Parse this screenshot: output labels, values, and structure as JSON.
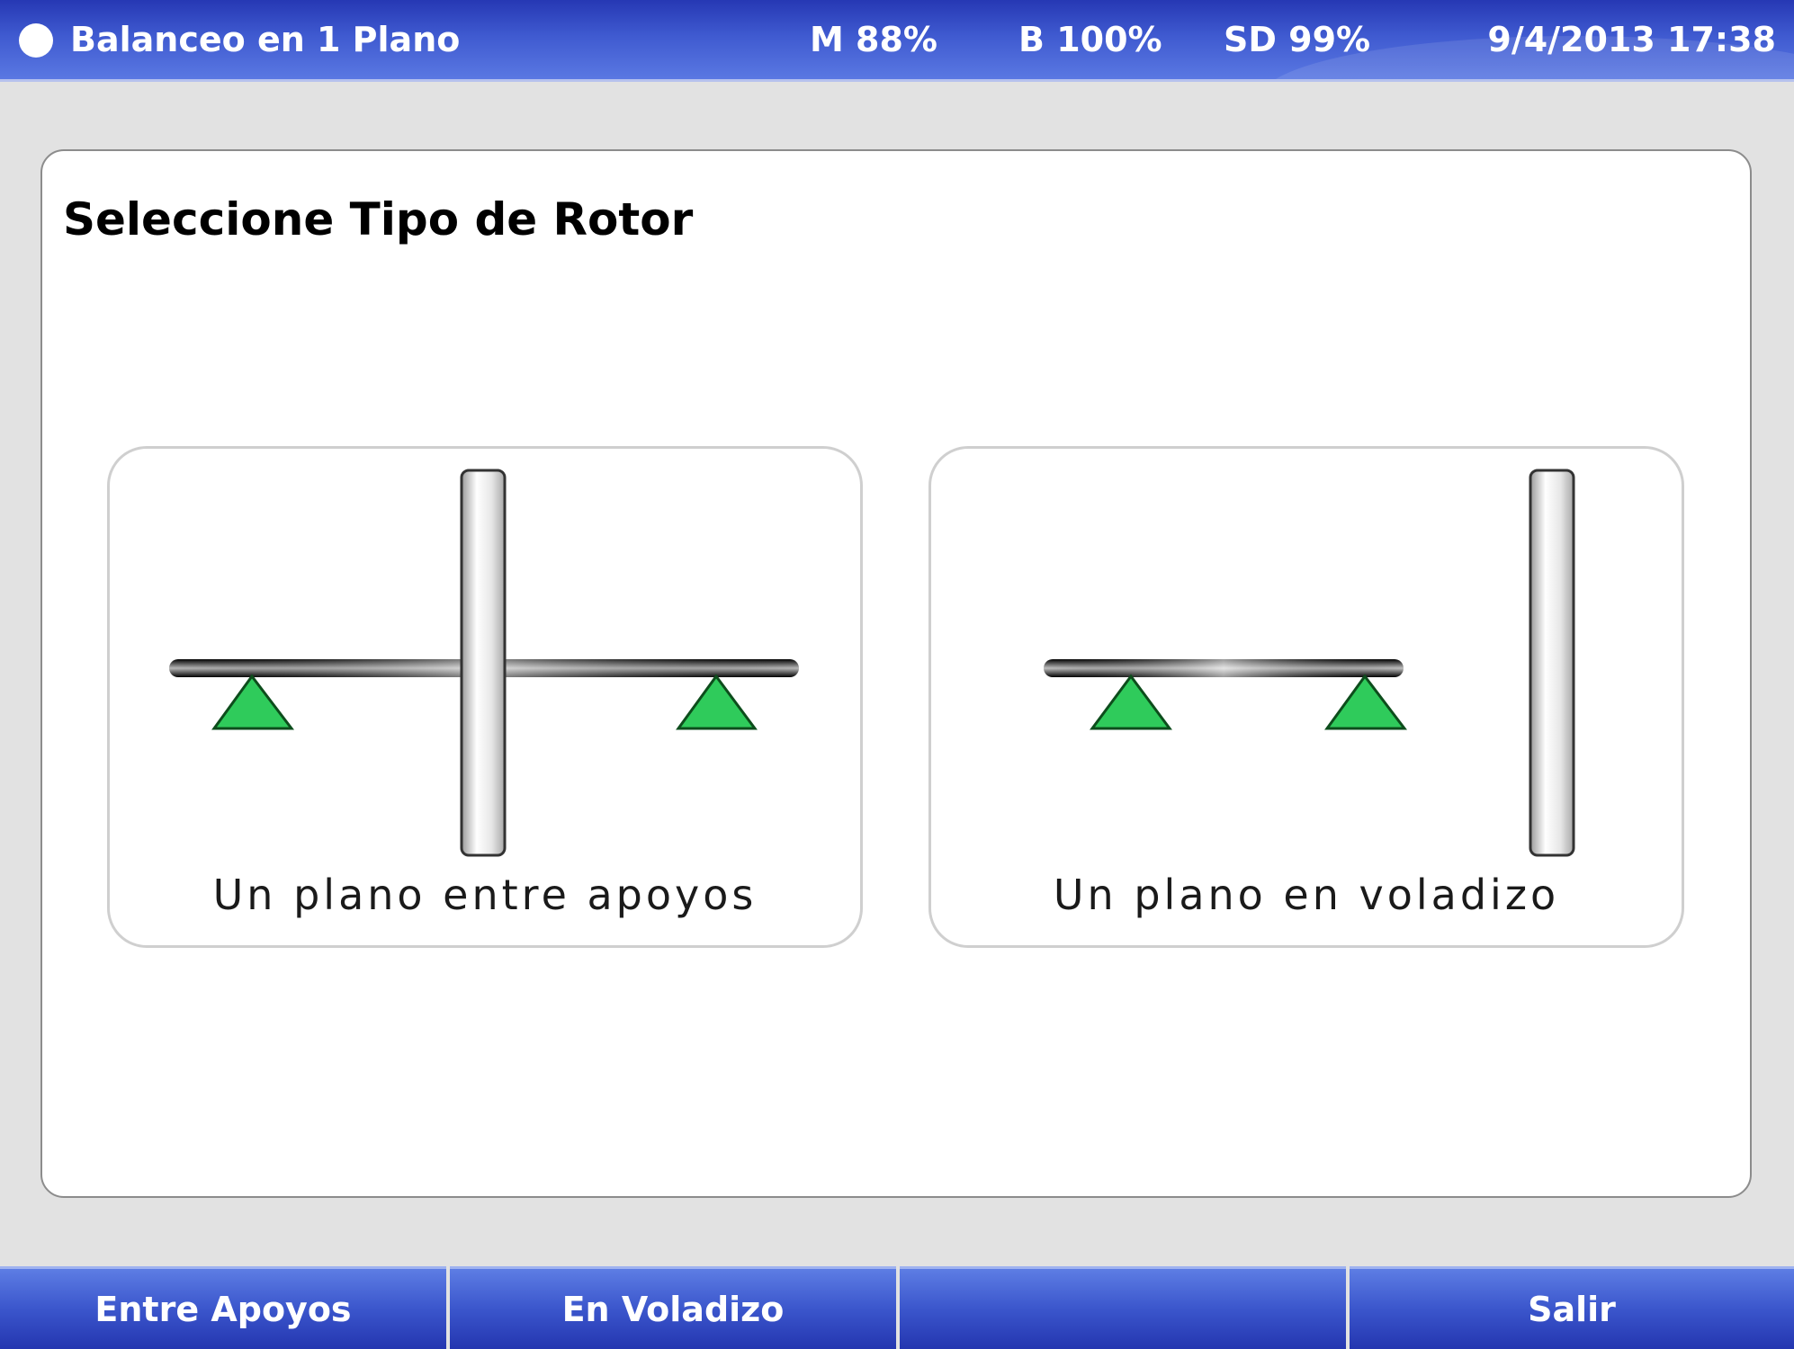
{
  "header": {
    "title": "Balanceo en 1 Plano",
    "memory": "M 88%",
    "battery": "B 100%",
    "sd": "SD 99%",
    "datetime": "9/4/2013 17:38"
  },
  "main": {
    "heading": "Seleccione Tipo de Rotor",
    "options": [
      {
        "caption": "Un plano entre apoyos",
        "icon": "rotor-between-supports-icon"
      },
      {
        "caption": "Un plano en voladizo",
        "icon": "rotor-overhung-icon"
      }
    ]
  },
  "softkeys": [
    {
      "label": "Entre Apoyos"
    },
    {
      "label": "En Voladizo"
    },
    {
      "label": ""
    },
    {
      "label": "Salir"
    }
  ],
  "colors": {
    "bar_blue": "#3b56cc",
    "support_green": "#2fcb5b",
    "panel_border": "#8c8c8c"
  }
}
